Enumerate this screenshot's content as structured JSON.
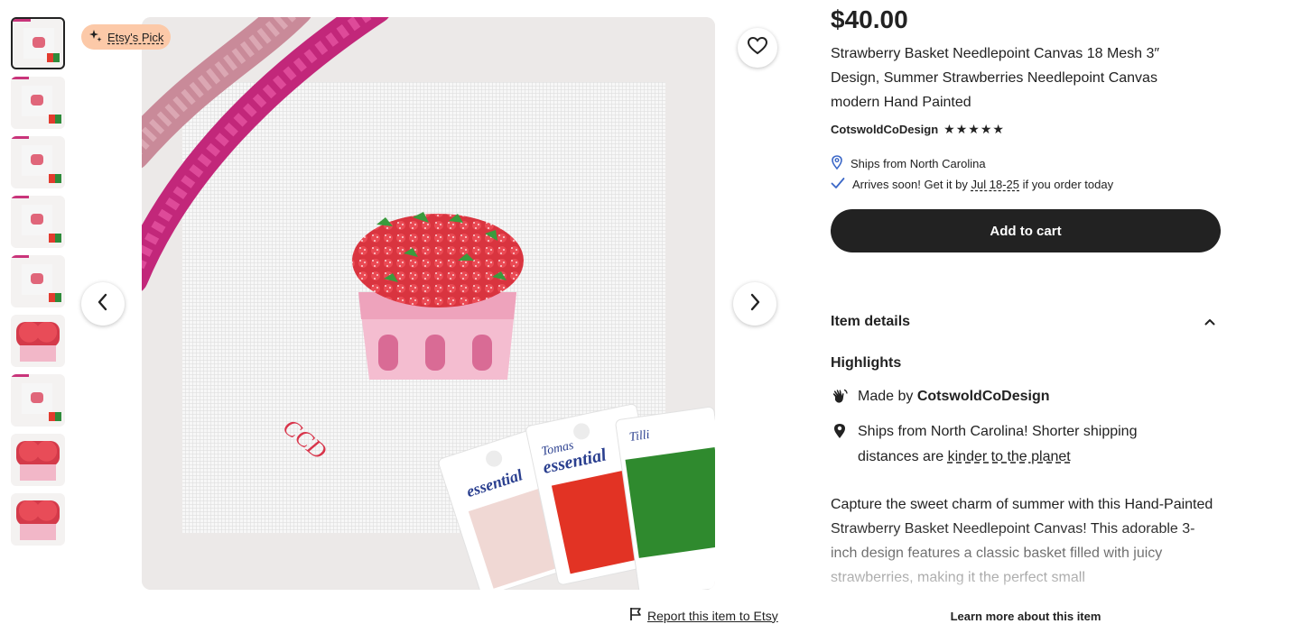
{
  "badge": {
    "label": "Etsy's Pick"
  },
  "listing": {
    "price": "$40.00",
    "title": "Strawberry Basket Needlepoint Canvas 18 Mesh 3″ Design, Summer Strawberries Needlepoint Canvas modern Hand Painted",
    "shop_name": "CotswoldCoDesign",
    "rating_stars": "★★★★★",
    "rating": 5
  },
  "shipping": {
    "ships_from": "Ships from North Carolina",
    "arrives_prefix": "Arrives soon! Get it by",
    "arrives_date": "Jul 18-25",
    "arrives_suffix": "if you order today"
  },
  "actions": {
    "add_to_cart": "Add to cart",
    "report": "Report this item to Etsy",
    "learn_more": "Learn more about this item"
  },
  "details": {
    "heading": "Item details",
    "highlights_heading": "Highlights",
    "made_by_prefix": "Made by",
    "made_by_shop": "CotswoldCoDesign",
    "ships_line": "Ships from North Carolina! Shorter shipping distances are",
    "ships_link": "kinder to the planet",
    "description": "Capture the sweet charm of summer with this Hand-Painted Strawberry Basket Needlepoint Canvas! This adorable 3-inch design features a classic basket filled with juicy strawberries, making it the perfect small"
  },
  "image_text": {
    "monogram": "CCD",
    "card_brand_top": "Tilli",
    "card_brand_right": "Tomas",
    "card_product": "essential"
  },
  "thumbnails": {
    "count": 9,
    "active_index": 0
  },
  "icons": [
    "sparkle-icon",
    "heart-icon",
    "chevron-left-icon",
    "chevron-right-icon",
    "flag-icon",
    "location-pin-icon",
    "checkmark-icon",
    "chevron-up-icon",
    "hand-wave-icon"
  ],
  "colors": {
    "button": "#222222",
    "badge": "#fcc9a8",
    "link_accent": "#3b67c7"
  }
}
